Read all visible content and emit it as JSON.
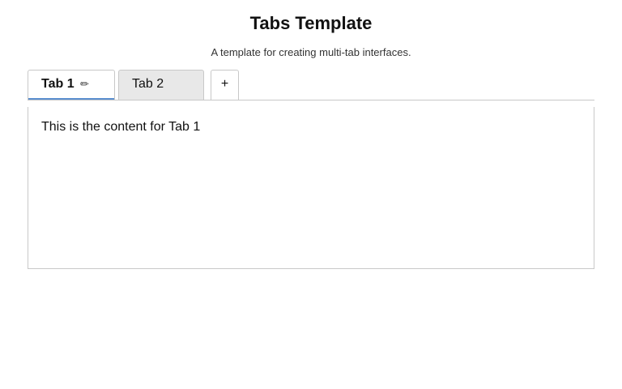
{
  "page": {
    "title": "Tabs Template",
    "subtitle": "A template for creating multi-tab interfaces."
  },
  "tabs": [
    {
      "label": "Tab 1",
      "active": true,
      "edit_icon": "pencil-icon",
      "edit_glyph": "✏"
    },
    {
      "label": "Tab 2",
      "active": false
    }
  ],
  "add_tab": {
    "label": "+"
  },
  "content": {
    "text": "This is the content for Tab 1"
  },
  "colors": {
    "active_tab_underline": "#5b8fd0",
    "inactive_tab_bg": "#e8e8e8",
    "border": "#c8c8c8"
  }
}
